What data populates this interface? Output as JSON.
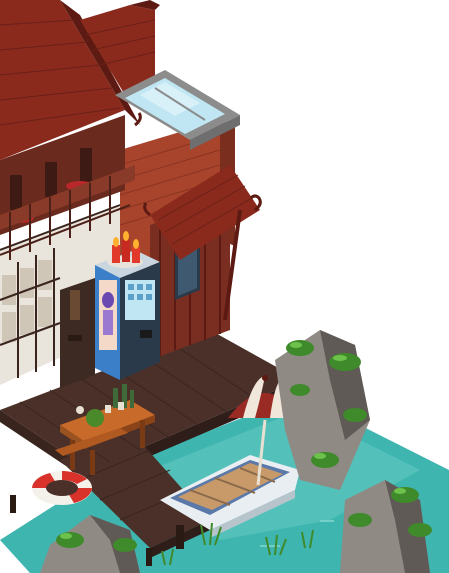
{
  "scene": {
    "description_free": true,
    "colors": {
      "roof": "#8a2a1c",
      "roof_dark": "#5c1a12",
      "brick": "#a8442c",
      "wood_dark": "#3d2a22",
      "wood_mid": "#5a3a2a",
      "deck": "#4a3028",
      "water": "#3fb5b0",
      "water_light": "#7fd6cf",
      "rock": "#8f8a84",
      "rock_dark": "#5f5a55",
      "leaf": "#3f8a2a",
      "leaf_light": "#6cc24a",
      "umbrella_red": "#9a2a24",
      "umbrella_white": "#f1e6da",
      "boat_white": "#e8eef2",
      "boat_blue": "#5a78a8",
      "glass": "#bfe6f2",
      "vending_blue": "#3a7fc8",
      "candle": "#e23a2a",
      "flame": "#ffb02e",
      "table": "#c86a2a",
      "buoy_red": "#d8322a",
      "buoy_white": "#f4f0ea"
    },
    "objects": [
      {
        "name": "pagoda-building"
      },
      {
        "name": "skylight"
      },
      {
        "name": "vending-machine"
      },
      {
        "name": "candles"
      },
      {
        "name": "wooden-dock"
      },
      {
        "name": "picnic-table"
      },
      {
        "name": "beach-umbrella"
      },
      {
        "name": "rowboat"
      },
      {
        "name": "life-buoy"
      },
      {
        "name": "rocks-with-plants"
      }
    ]
  }
}
